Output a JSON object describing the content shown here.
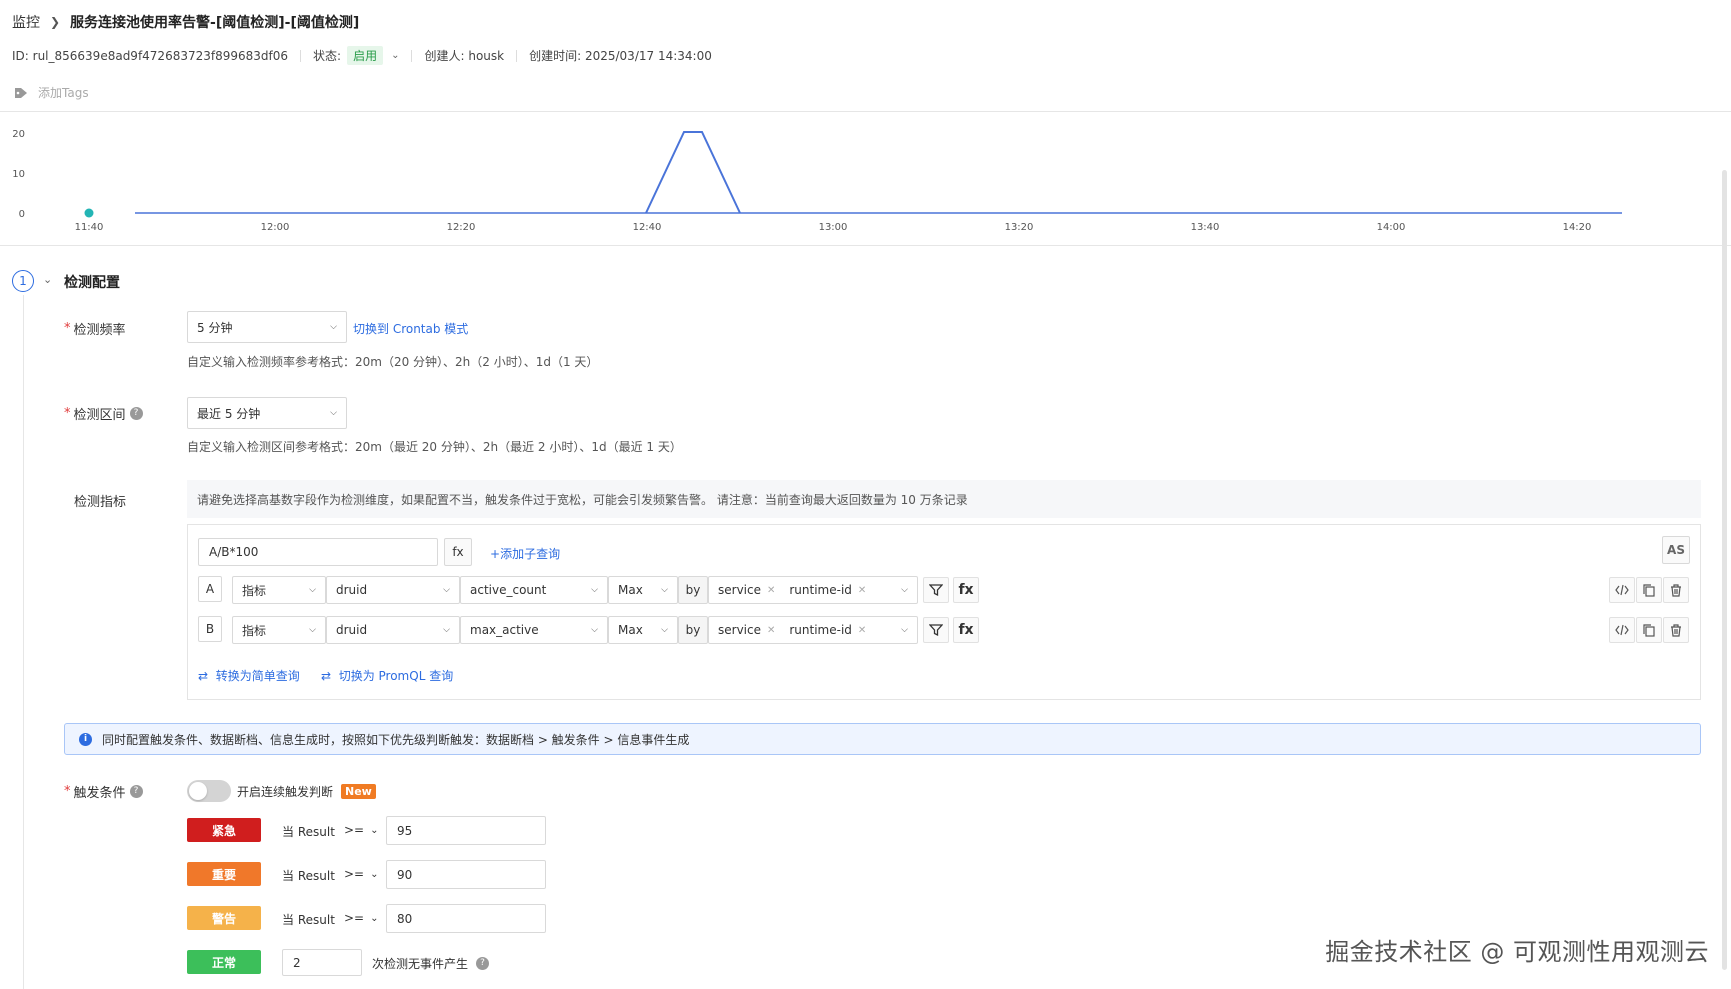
{
  "breadcrumb": {
    "root": "监控",
    "title": "服务连接池使用率告警-[阈值检测]-[阈值检测]"
  },
  "meta": {
    "id": "ID: rul_856639e8ad9f472683723f899683df06",
    "status_label": "状态:",
    "status_value": "启用",
    "creator": "创建人: housk",
    "created_at": "创建时间: 2025/03/17 14:34:00"
  },
  "tags": {
    "placeholder": "添加Tags"
  },
  "chart_data": {
    "type": "line",
    "y_ticks": [
      "20",
      "10",
      "0"
    ],
    "x_ticks": [
      "11:40",
      "12:00",
      "12:20",
      "12:40",
      "13:00",
      "13:20",
      "13:40",
      "14:00",
      "14:20"
    ],
    "series_color": "#4a74d9",
    "marker_color": "#23b5b5"
  },
  "section": {
    "step": "1",
    "title": "检测配置"
  },
  "frequency": {
    "label": "检测频率",
    "value": "5 分钟",
    "crontab_link": "切换到 Crontab 模式",
    "hint": "自定义输入检测频率参考格式：20m（20 分钟）、2h（2 小时）、1d（1 天）"
  },
  "interval": {
    "label": "检测区间",
    "value": "最近 5 分钟",
    "hint": "自定义输入检测区间参考格式：20m（最近 20 分钟）、2h（最近 2 小时）、1d（最近 1 天）"
  },
  "metrics": {
    "label": "检测指标",
    "notice": "请避免选择高基数字段作为检测维度，如果配置不当，触发条件过于宽松，可能会引发频繁告警。 请注意：当前查询最大返回数量为 10 万条记录",
    "expression": "A/B*100",
    "fx": "fx",
    "add_subquery": "添加子查询",
    "as_label": "AS",
    "by": "by",
    "queries": [
      {
        "letter": "A",
        "type": "指标",
        "source": "druid",
        "field": "active_count",
        "agg": "Max",
        "groups": [
          "service",
          "runtime-id"
        ]
      },
      {
        "letter": "B",
        "type": "指标",
        "source": "druid",
        "field": "max_active",
        "agg": "Max",
        "groups": [
          "service",
          "runtime-id"
        ]
      }
    ],
    "to_simple": "转换为简单查询",
    "to_promql": "切换为 PromQL 查询"
  },
  "info_bar": "同时配置触发条件、数据断档、信息生成时，按照如下优先级判断触发：数据断档 > 触发条件 > 信息事件生成",
  "trigger": {
    "label": "触发条件",
    "toggle_label": "开启连续触发判断",
    "new_badge": "New",
    "rules": [
      {
        "level": "紧急",
        "color": "#d01e1e",
        "prefix": "当 Result",
        "op": ">=",
        "value": "95"
      },
      {
        "level": "重要",
        "color": "#f0782a",
        "prefix": "当 Result",
        "op": ">=",
        "value": "90"
      },
      {
        "level": "警告",
        "color": "#f5b24a",
        "prefix": "当 Result",
        "op": ">=",
        "value": "80"
      }
    ],
    "normal": {
      "level": "正常",
      "color": "#3cbf5a",
      "value": "2",
      "suffix": "次检测无事件产生"
    }
  },
  "watermark": "掘金技术社区 @ 可观测性用观测云"
}
